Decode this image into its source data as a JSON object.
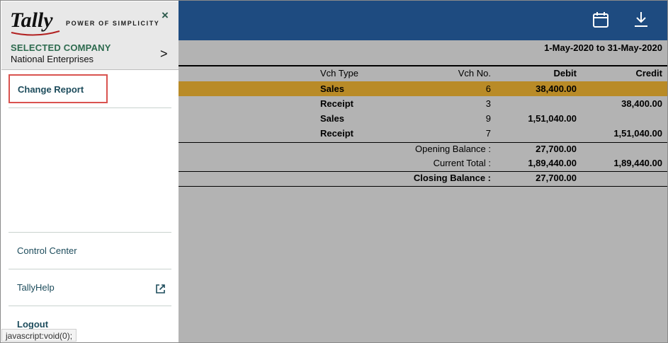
{
  "drawer": {
    "logo_text": "Tally",
    "tagline": "POWER OF SIMPLICITY",
    "close_glyph": "×",
    "selected_company_label": "SELECTED COMPANY",
    "company_name": "National Enterprises",
    "chevron_glyph": ">",
    "change_report": "Change Report",
    "control_center": "Control Center",
    "tallyhelp": "TallyHelp",
    "logout": "Logout"
  },
  "status_bar": "javascript:void(0);",
  "topbar": {
    "calendar_icon": "calendar-icon",
    "download_icon": "download-icon",
    "color": "#1e4b80"
  },
  "report": {
    "period": "1-May-2020 to 31-May-2020",
    "columns": {
      "type": "Vch Type",
      "no": "Vch No.",
      "debit": "Debit",
      "credit": "Credit"
    },
    "rows": [
      {
        "type": "Sales",
        "no": "6",
        "debit": "38,400.00",
        "credit": ""
      },
      {
        "type": "Receipt",
        "no": "3",
        "debit": "",
        "credit": "38,400.00"
      },
      {
        "type": "Sales",
        "no": "9",
        "debit": "1,51,040.00",
        "credit": ""
      },
      {
        "type": "Receipt",
        "no": "7",
        "debit": "",
        "credit": "1,51,040.00"
      }
    ],
    "opening": {
      "label": "Opening Balance :",
      "debit": "27,700.00",
      "credit": ""
    },
    "current": {
      "label": "Current Total :",
      "debit": "1,89,440.00",
      "credit": "1,89,440.00"
    },
    "closing": {
      "label": "Closing Balance :",
      "debit": "27,700.00",
      "credit": ""
    },
    "highlight_color": "#b98b27"
  }
}
